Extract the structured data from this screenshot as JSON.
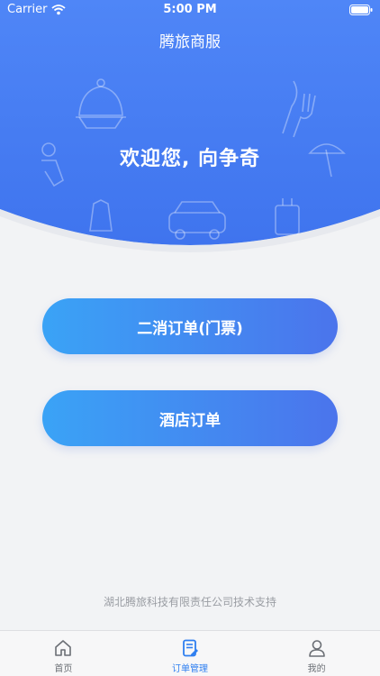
{
  "status_bar": {
    "carrier": "Carrier",
    "time": "5:00 PM"
  },
  "header": {
    "title": "腾旅商服",
    "welcome": "欢迎您, 向争奇"
  },
  "actions": {
    "secondary_order_label": "二消订单(门票)",
    "hotel_order_label": "酒店订单"
  },
  "footer": {
    "support_text": "湖北腾旅科技有限责任公司技术支持"
  },
  "tabbar": {
    "items": [
      {
        "label": "首页",
        "icon": "home-icon",
        "active": false
      },
      {
        "label": "订单管理",
        "icon": "order-icon",
        "active": true
      },
      {
        "label": "我的",
        "icon": "user-icon",
        "active": false
      }
    ]
  },
  "colors": {
    "hero_top": "#4f86f7",
    "hero_bottom": "#3f74ee",
    "button_start": "#3aa3f6",
    "button_end": "#4b74ec",
    "tab_active": "#2f7ff0"
  }
}
